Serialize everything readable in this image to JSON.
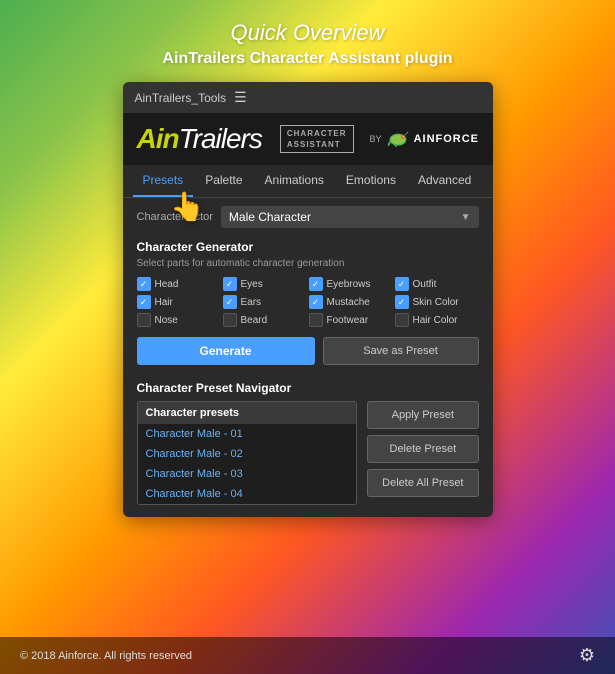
{
  "page": {
    "title": "Quick Overview",
    "subtitle": "AinTrailers Character Assistant plugin"
  },
  "panel": {
    "header_label": "AinTrailers_Tools",
    "logo_ain": "Ain",
    "logo_trailers": "Trailers",
    "logo_badge": "CHARACTER ASSISTANT",
    "logo_by": "BY",
    "ainforce_label": "AINFORCE"
  },
  "nav": {
    "tabs": [
      {
        "label": "Presets",
        "active": true
      },
      {
        "label": "Palette",
        "active": false
      },
      {
        "label": "Animations",
        "active": false
      },
      {
        "label": "Emotions",
        "active": false
      },
      {
        "label": "Advanced",
        "active": false
      }
    ]
  },
  "actor": {
    "label": "Character Actor",
    "value": "Male Character"
  },
  "generator": {
    "title": "Character Generator",
    "desc": "Select parts for automatic character generation",
    "checkboxes": [
      {
        "label": "Head",
        "checked": true
      },
      {
        "label": "Eyes",
        "checked": true
      },
      {
        "label": "Eyebrows",
        "checked": true
      },
      {
        "label": "Outfit",
        "checked": true
      },
      {
        "label": "Hair",
        "checked": true
      },
      {
        "label": "Ears",
        "checked": true
      },
      {
        "label": "Mustache",
        "checked": true
      },
      {
        "label": "Skin Color",
        "checked": true
      },
      {
        "label": "Nose",
        "checked": false
      },
      {
        "label": "Beard",
        "checked": false
      },
      {
        "label": "Footwear",
        "checked": false
      },
      {
        "label": "Hair Color",
        "checked": false
      }
    ],
    "btn_generate": "Generate",
    "btn_save": "Save as Preset"
  },
  "preset_navigator": {
    "title": "Character Preset Navigator",
    "list_header": "Character presets",
    "presets": [
      {
        "label": "Character Male - 01"
      },
      {
        "label": "Character Male - 02"
      },
      {
        "label": "Character Male - 03"
      },
      {
        "label": "Character Male - 04"
      }
    ],
    "btn_apply": "Apply Preset",
    "btn_delete": "Delete Preset",
    "btn_delete_all": "Delete All Preset"
  },
  "footer": {
    "copyright": "© 2018 Ainforce. All rights reserved"
  }
}
